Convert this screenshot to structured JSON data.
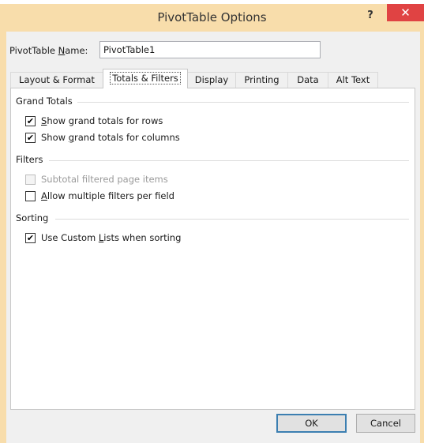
{
  "window": {
    "title": "PivotTable Options",
    "help_label": "?",
    "close_label": "✕"
  },
  "name_field": {
    "label_pre": "PivotTable ",
    "label_mnemonic": "N",
    "label_post": "ame:",
    "value": "PivotTable1"
  },
  "tabs": [
    {
      "label": "Layout & Format",
      "active": false
    },
    {
      "label": "Totals & Filters",
      "active": true
    },
    {
      "label": "Display",
      "active": false
    },
    {
      "label": "Printing",
      "active": false
    },
    {
      "label": "Data",
      "active": false
    },
    {
      "label": "Alt Text",
      "active": false
    }
  ],
  "sections": {
    "grand_totals": {
      "title": "Grand Totals",
      "rows_pre": "",
      "rows_mnemonic": "S",
      "rows_post": "how grand totals for rows",
      "rows_checked": true,
      "cols_pre": "Show ",
      "cols_mnemonic": "g",
      "cols_post": "rand totals for columns",
      "cols_checked": true
    },
    "filters": {
      "title": "Filters",
      "subtotal_label": "Subtotal filtered page items",
      "subtotal_checked": false,
      "subtotal_enabled": false,
      "multi_pre": "",
      "multi_mnemonic": "A",
      "multi_post": "llow multiple filters per field",
      "multi_checked": false
    },
    "sorting": {
      "title": "Sorting",
      "custom_pre": "Use Custom ",
      "custom_mnemonic": "L",
      "custom_post": "ists when sorting",
      "custom_checked": true
    }
  },
  "buttons": {
    "ok": "OK",
    "cancel": "Cancel"
  },
  "check_glyph": "✔"
}
